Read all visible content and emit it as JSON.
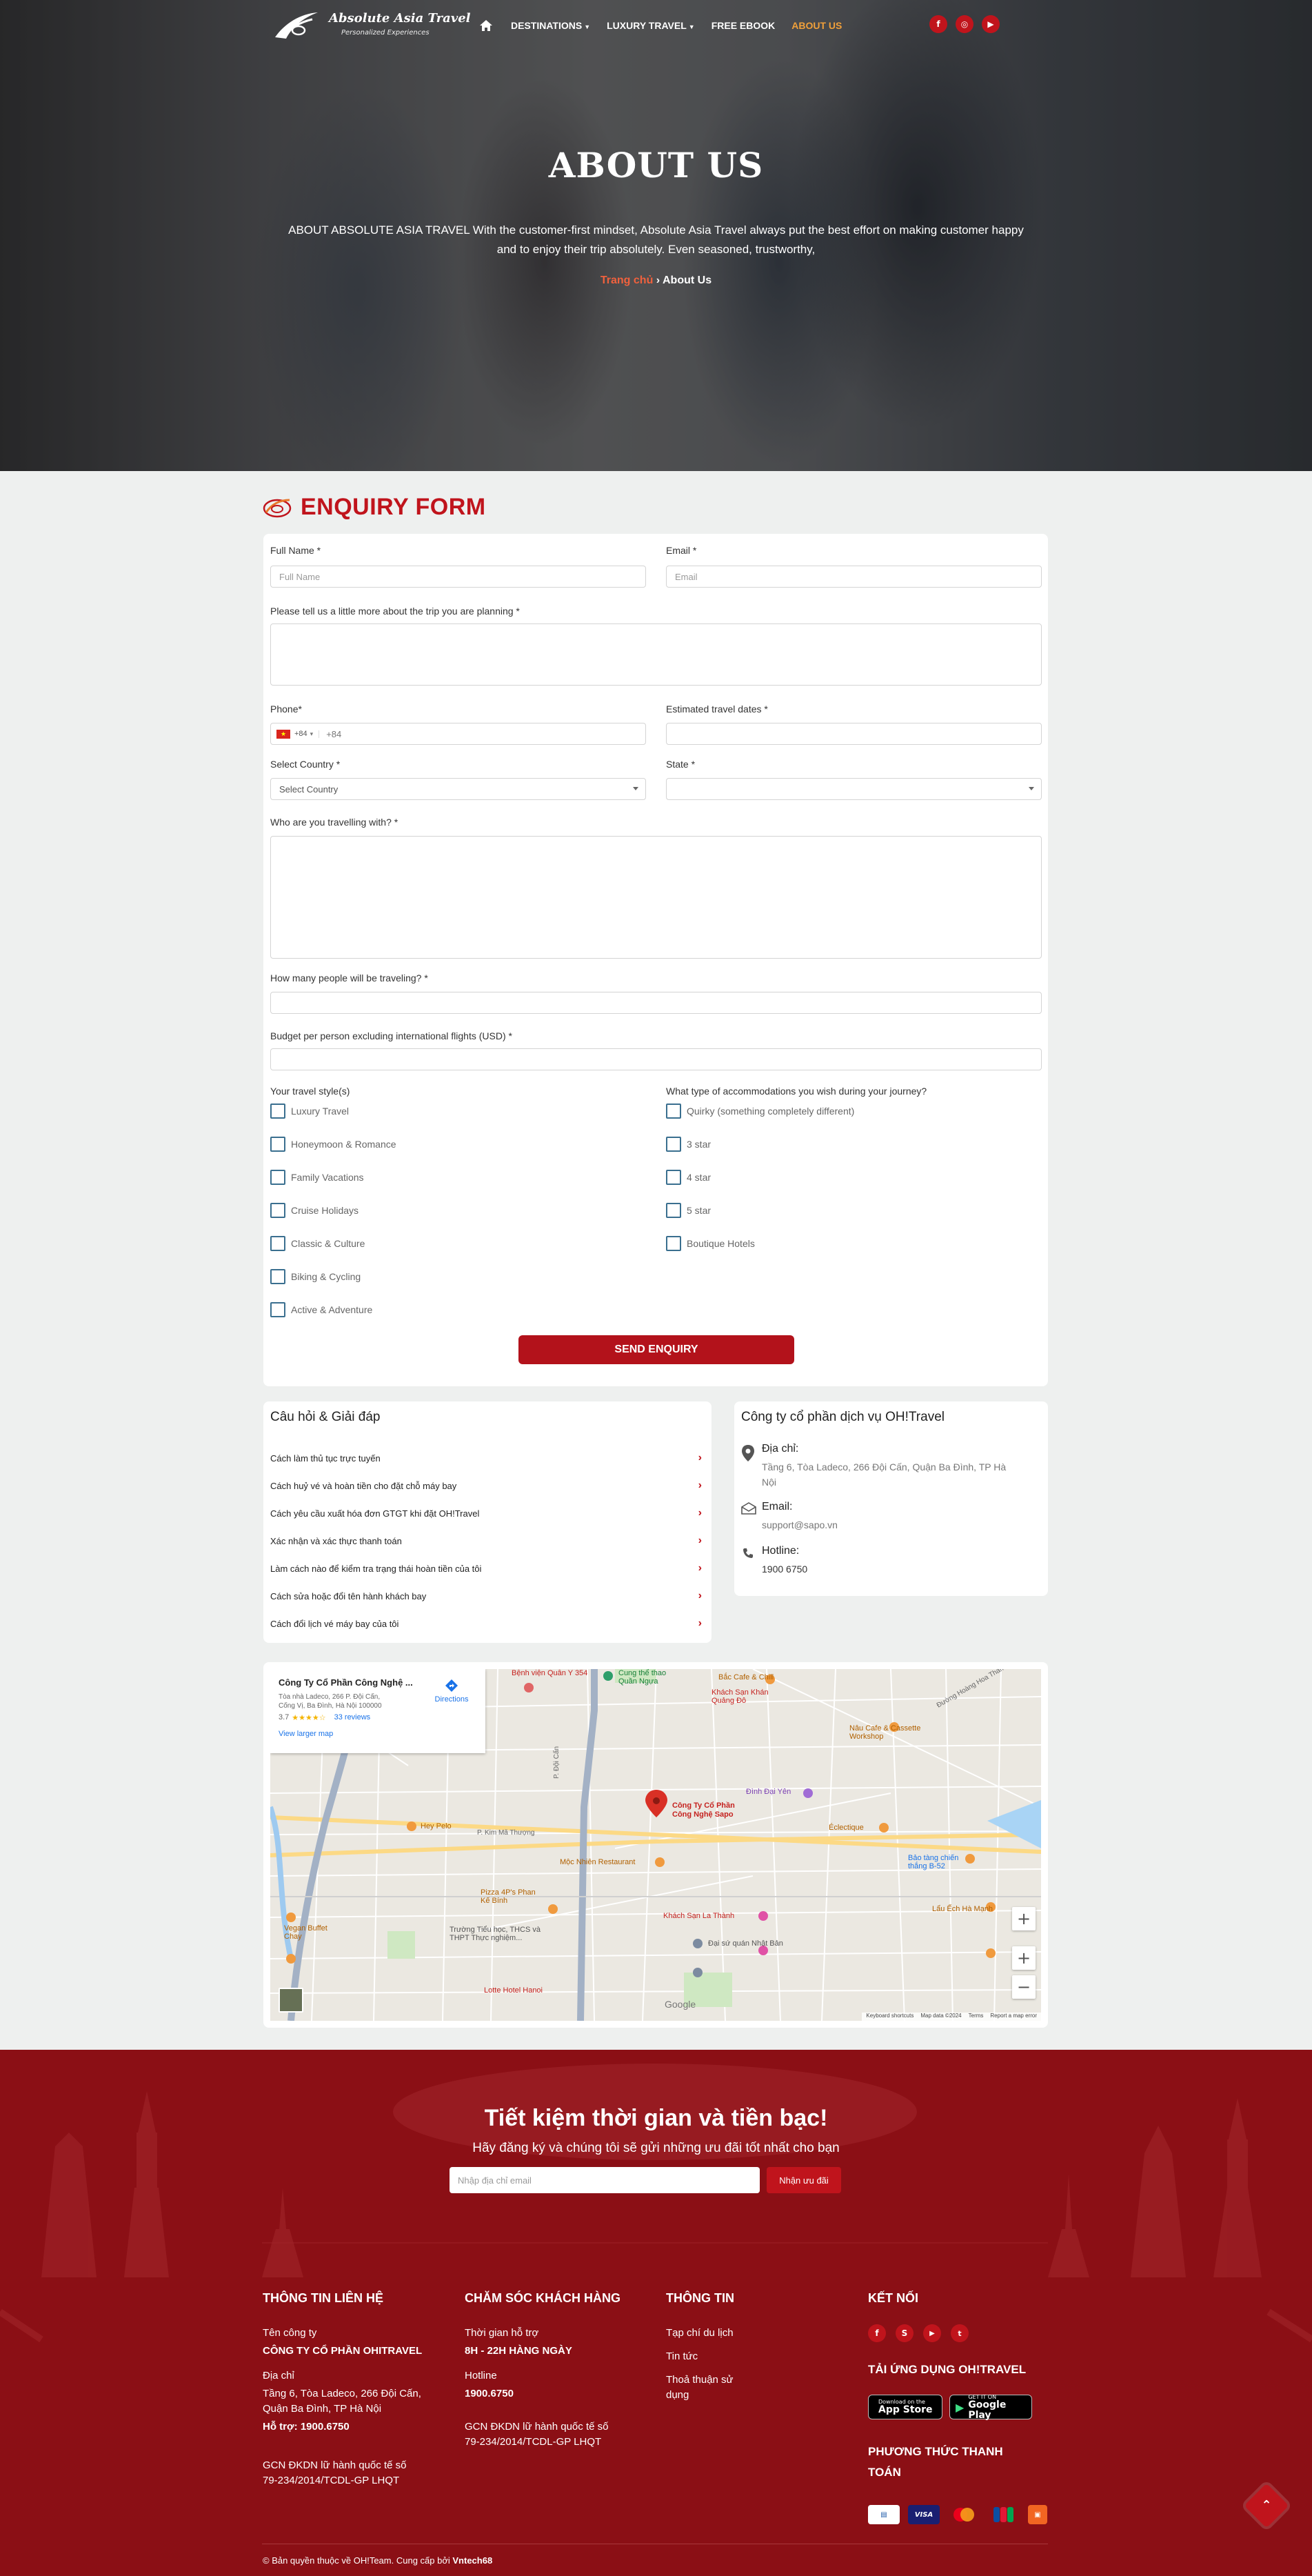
{
  "nav": {
    "brand": "Absolute Asia Travel",
    "slogan": "Personalized Experiences",
    "items": [
      "DESTINATIONS",
      "LUXURY TRAVEL",
      "FREE EBOOK",
      "ABOUT US"
    ]
  },
  "hero": {
    "title": "ABOUT US",
    "description_line1": "ABOUT ABSOLUTE ASIA TRAVEL With the customer-first mindset, Absolute Asia Travel always put the best effort on making customer happy",
    "description_line2": "and to enjoy their trip absolutely. Even seasoned, trustworthy,",
    "breadcrumb_home": "Trang chủ",
    "breadcrumb_sep": "›",
    "breadcrumb_current": "About Us"
  },
  "form": {
    "title": "ENQUIRY FORM",
    "full_name_label": "Full Name *",
    "full_name_placeholder": "Full Name",
    "email_label": "Email *",
    "email_placeholder": "Email",
    "trip_label": "Please tell us a little more about the trip you are planning *",
    "phone_label": "Phone*",
    "phone_code": "+84",
    "phone_value": "+84",
    "dates_label": "Estimated travel dates *",
    "country_label": "Select Country *",
    "country_value": "Select Country",
    "state_label": "State *",
    "companions_label": "Who are you travelling with? *",
    "people_label": "How many people will be traveling? *",
    "budget_label": "Budget per person excluding international flights (USD) *",
    "style_label": "Your travel style(s)",
    "styles": [
      "Luxury Travel",
      "Honeymoon & Romance",
      "Family Vacations",
      "Cruise Holidays",
      "Classic & Culture",
      "Biking & Cycling",
      "Active & Adventure"
    ],
    "accom_label": "What type of accommodations you wish during your journey?",
    "accoms": [
      "Quirky (something completely different)",
      "3 star",
      "4 star",
      "5 star",
      "Boutique Hotels"
    ],
    "submit": "SEND ENQUIRY"
  },
  "faq": {
    "title": "Câu hỏi & Giải đáp",
    "items": [
      "Cách làm thủ tục trực tuyến",
      "Cách huỷ vé và hoàn tiền cho đặt chỗ máy bay",
      "Cách yêu cầu xuất hóa đơn GTGT khi đặt OH!Travel",
      "Xác nhận và xác thực thanh toán",
      "Làm cách nào để kiểm tra trạng thái hoàn tiền của tôi",
      "Cách sửa hoặc đổi tên hành khách bay",
      "Cách đổi lịch vé máy bay của tôi"
    ]
  },
  "company": {
    "title": "Công ty cổ phần dịch vụ OH!Travel",
    "address_label": "Địa chỉ:",
    "address_line1": "Tầng 6, Tòa Ladeco, 266 Đội Cấn, Quận Ba Đình, TP Hà",
    "address_line2": "Nội",
    "email_label": "Email:",
    "email": "support@sapo.vn",
    "hotline_label": "Hotline:",
    "hotline": "1900 6750"
  },
  "map": {
    "place_name": "Công Ty Cổ Phần Công Nghệ ...",
    "place_addr1": "Tòa nhà Ladeco, 266 P. Đội Cấn,",
    "place_addr2": "Cống Vị, Ba Đình, Hà Nội 100000",
    "rating": "3.7",
    "stars": "★★★★☆",
    "reviews": "33 reviews",
    "directions": "Directions",
    "larger": "View larger map",
    "marker_label1": "Công Ty Cổ Phần",
    "marker_label2": "Công Nghệ Sapo",
    "labels": [
      "Bệnh viện Quân Y 354",
      "Cung thể thao Quần Ngựa",
      "Bắc Cafe & Chill",
      "Khách Sạn Khán Quảng Đô",
      "Nâu Cafe & Cassette Workshop",
      "Đình Đại Yên",
      "Éclectique",
      "Bảo tàng chiến thắng B-52",
      "Hey Pelo",
      "Mộc Nhiên Restaurant",
      "Pizza 4P's Phan Kế Bính",
      "Khách Sạn La Thành",
      "Đại sứ quán Nhật Bản",
      "Lẩu Ếch Hà Mạnh",
      "Vegan Buffet Chay",
      "Trường Tiểu học, THCS và THPT Thực nghiệm...",
      "Lotte Hotel Hanoi",
      "Đường Hoàng Hoa Thám",
      "P. Kim Mã Thượng",
      "P. Đội Cấn"
    ],
    "google": "Google",
    "footer_links": [
      "Keyboard shortcuts",
      "Map data ©2024",
      "Terms",
      "Report a map error"
    ]
  },
  "newsletter": {
    "title": "Tiết kiệm thời gian và tiền bạc!",
    "subtitle": "Hãy đăng ký và chúng tôi sẽ gửi những ưu đãi tốt nhất cho bạn",
    "placeholder": "Nhập địa chỉ email",
    "button": "Nhận ưu đãi"
  },
  "footer": {
    "col1_title": "THÔNG TIN LIÊN HỆ",
    "company_label": "Tên công ty",
    "company_name": "CÔNG TY CỔ PHẦN OHITRAVEL",
    "address_label": "Địa chỉ",
    "address_line1": "Tầng 6, Tòa Ladeco, 266 Đội Cấn,",
    "address_line2": "Quận Ba Đình, TP Hà Nội",
    "support": "Hỗ trợ: 1900.6750",
    "license_line1": "GCN ĐKDN lữ hành quốc tế số",
    "license_line2": "79-234/2014/TCDL-GP LHQT",
    "col2_title": "CHĂM SÓC KHÁCH HÀNG",
    "hours_label": "Thời gian hỗ trợ",
    "hours": "8H - 22H HÀNG NGÀY",
    "hotline_label": "Hotline",
    "hotline": "1900.6750",
    "col2_license_line1": "GCN ĐKDN lữ hành quốc tế số",
    "col2_license_line2": "79-234/2014/TCDL-GP LHQT",
    "col3_title": "THÔNG TIN",
    "links": [
      "Tạp chí du lịch",
      "Tin tức",
      "Thoả thuận sử",
      "dụng"
    ],
    "col4_title": "KẾT NỐI",
    "app_title": "TẢI ỨNG DỤNG OH!TRAVEL",
    "appstore_small": "Download on the",
    "appstore": "App Store",
    "gplay_small": "GET IT ON",
    "gplay": "Google Play",
    "pay_title_line1": "PHƯƠNG THỨC THANH",
    "pay_title_line2": "TOÁN",
    "copyright_pre": "© Bản quyền thuộc về OH!Team. Cung cấp bởi ",
    "copyright_brand": "Vntech68"
  },
  "colors": {
    "primary": "#c0141c",
    "footer_bg": "#8b0f15",
    "active_nav": "#f0a03a",
    "checkbox": "#3a6f8f"
  }
}
